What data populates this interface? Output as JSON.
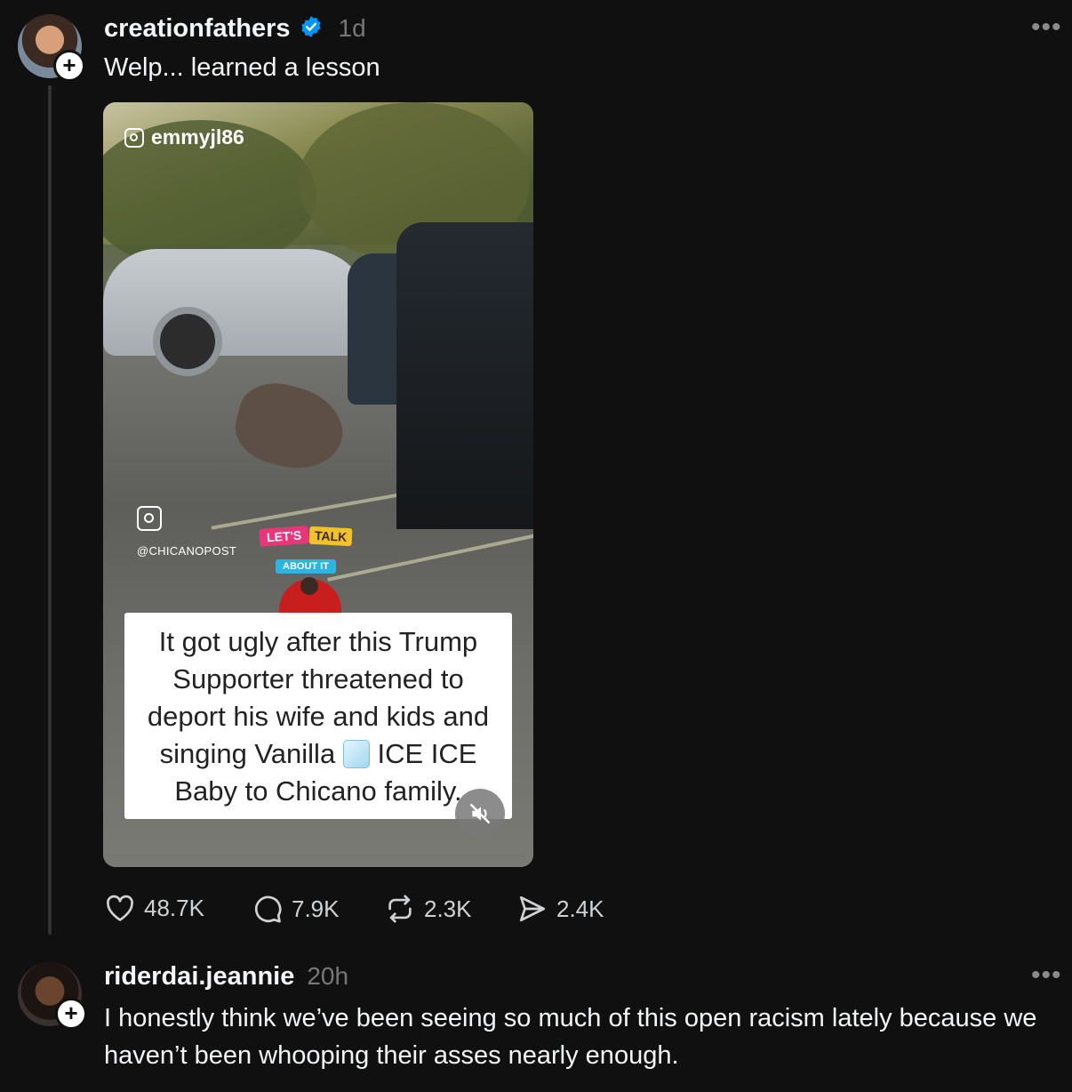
{
  "post": {
    "username": "creationfathers",
    "verified": true,
    "time": "1d",
    "text": "Welp... learned a lesson",
    "more": "•••",
    "media": {
      "watermark_top": "emmyjl86",
      "watermark_handle": "@CHICANOPOST",
      "sticker_line1a": "LET'S",
      "sticker_line1b": "TALK",
      "sticker_line2": "ABOUT IT",
      "caption_line1": "It got ugly after this Trump",
      "caption_line2": "Supporter threatened to",
      "caption_line3": "deport his wife and kids and",
      "caption_line4a": "singing Vanilla",
      "caption_line4b": "ICE ICE",
      "caption_line5": "Baby to Chicano family.",
      "muted": true
    },
    "actions": {
      "likes": "48.7K",
      "comments": "7.9K",
      "reposts": "2.3K",
      "shares": "2.4K"
    }
  },
  "reply": {
    "username": "riderdai.jeannie",
    "time": "20h",
    "text": "I honestly think we’ve been seeing so much of this open racism lately because we haven’t been whooping their asses nearly enough.",
    "more": "•••"
  },
  "colors": {
    "background": "#101010",
    "text": "#f3f5f7",
    "muted": "#777777",
    "verified": "#0095f6"
  }
}
